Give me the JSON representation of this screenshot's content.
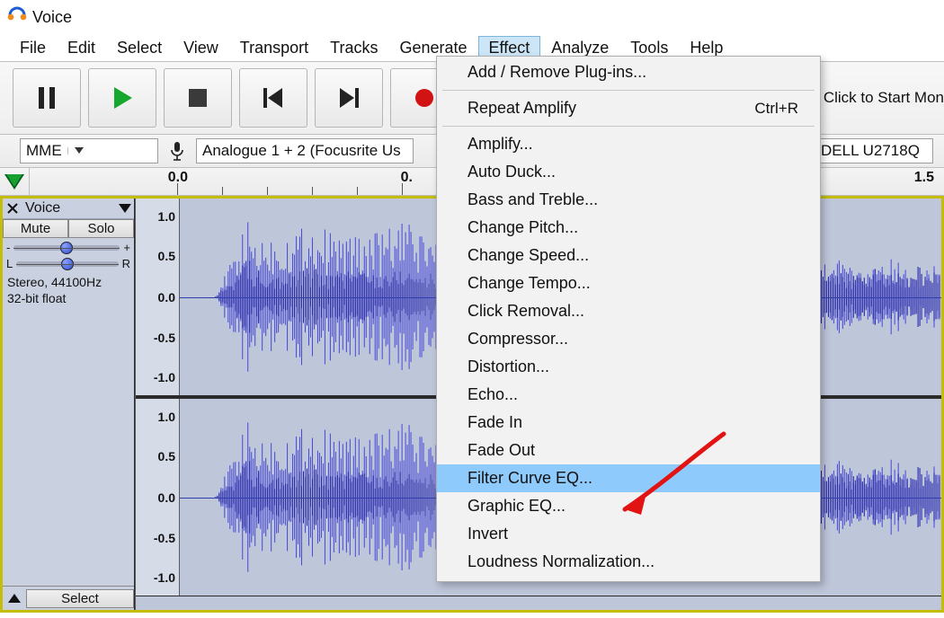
{
  "title": "Voice",
  "menubar": [
    "File",
    "Edit",
    "Select",
    "View",
    "Transport",
    "Tracks",
    "Generate",
    "Effect",
    "Analyze",
    "Tools",
    "Help"
  ],
  "menubar_open_index": 7,
  "monitor_hint": "Click to Start Mon",
  "devices": {
    "host": "MME",
    "input": "Analogue 1 + 2 (Focusrite Us",
    "output": "DELL U2718Q"
  },
  "ruler": {
    "labels": [
      "0.0",
      "0.",
      "1.5"
    ]
  },
  "track": {
    "name": "Voice",
    "mute": "Mute",
    "solo": "Solo",
    "gain_markers": [
      "-",
      "+"
    ],
    "pan_markers": [
      "L",
      "R"
    ],
    "meta_line1": "Stereo, 44100Hz",
    "meta_line2": "32-bit float",
    "vscale": [
      "1.0",
      "0.5",
      "0.0",
      "-0.5",
      "-1.0"
    ],
    "select": "Select"
  },
  "effect_menu": {
    "items": [
      {
        "label": "Add / Remove Plug-ins...",
        "type": "item"
      },
      {
        "type": "sep"
      },
      {
        "label": "Repeat Amplify",
        "accel": "Ctrl+R",
        "type": "item"
      },
      {
        "type": "sep"
      },
      {
        "label": "Amplify...",
        "type": "item"
      },
      {
        "label": "Auto Duck...",
        "type": "item"
      },
      {
        "label": "Bass and Treble...",
        "type": "item"
      },
      {
        "label": "Change Pitch...",
        "type": "item"
      },
      {
        "label": "Change Speed...",
        "type": "item"
      },
      {
        "label": "Change Tempo...",
        "type": "item"
      },
      {
        "label": "Click Removal...",
        "type": "item"
      },
      {
        "label": "Compressor...",
        "type": "item"
      },
      {
        "label": "Distortion...",
        "type": "item"
      },
      {
        "label": "Echo...",
        "type": "item"
      },
      {
        "label": "Fade In",
        "type": "item"
      },
      {
        "label": "Fade Out",
        "type": "item"
      },
      {
        "label": "Filter Curve EQ...",
        "type": "item",
        "highlight": true
      },
      {
        "label": "Graphic EQ...",
        "type": "item"
      },
      {
        "label": "Invert",
        "type": "item"
      },
      {
        "label": "Loudness Normalization...",
        "type": "item"
      }
    ]
  }
}
